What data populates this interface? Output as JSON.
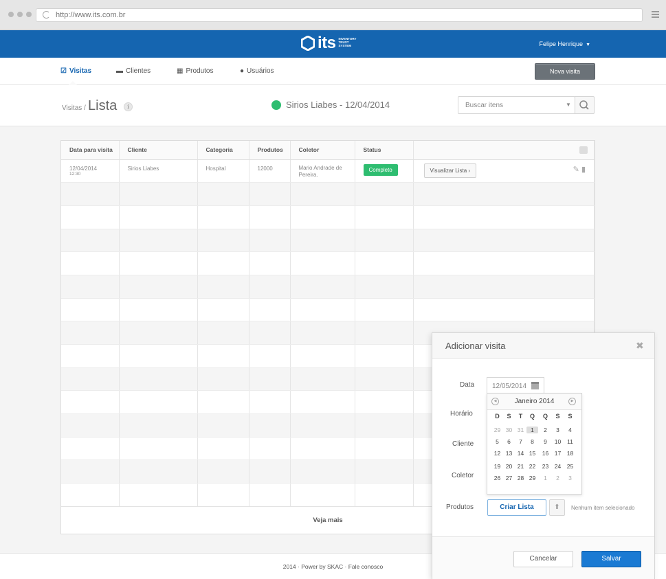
{
  "browser": {
    "url": "http://www.its.com.br"
  },
  "header": {
    "logo_text": "its",
    "logo_sub": "INVENTORY TRUST SYSTEM",
    "user_name": "Felipe Henrique",
    "brand_color": "#1565b0"
  },
  "nav": {
    "items": [
      {
        "label": "Visitas",
        "icon": "check-square-icon",
        "active": true
      },
      {
        "label": "Clientes",
        "icon": "briefcase-icon"
      },
      {
        "label": "Produtos",
        "icon": "cubes-icon"
      },
      {
        "label": "Usuários",
        "icon": "user-icon"
      }
    ],
    "new_visit_label": "Nova visita"
  },
  "subheader": {
    "breadcrumb": "Visitas /",
    "title": "Lista",
    "visit_title": "Sirios Liabes - 12/04/2014",
    "status_color": "#2ebd70",
    "search_placeholder": "Buscar itens"
  },
  "table": {
    "columns": [
      "Data para visita",
      "Cliente",
      "Categoria",
      "Produtos",
      "Coletor",
      "Status",
      ""
    ],
    "rows": [
      {
        "date": "12/04/2014",
        "time": "12:30",
        "cliente": "Sirios Liabes",
        "categoria": "Hospital",
        "produtos": "12000",
        "coletor": "Mario Andrade de Pereira.",
        "status": "Completo",
        "action": "Visualizar Lista"
      }
    ],
    "more_label": "Veja mais"
  },
  "footer": {
    "text": "2014 · Power by SKAC · Fale conosco"
  },
  "modal": {
    "title": "Adicionar visita",
    "labels": {
      "data": "Data",
      "horario": "Horário",
      "cliente": "Cliente",
      "coletor": "Coletor",
      "produtos": "Produtos"
    },
    "date_value": "12/05/2014",
    "calendar": {
      "month": "Janeiro 2014",
      "weekdays": [
        "D",
        "S",
        "T",
        "Q",
        "Q",
        "S",
        "S"
      ],
      "weeks": [
        [
          "29",
          "30",
          "31",
          "1",
          "2",
          "3",
          "4"
        ],
        [
          "5",
          "6",
          "7",
          "8",
          "9",
          "10",
          "11"
        ],
        [
          "12",
          "13",
          "14",
          "15",
          "16",
          "17",
          "18"
        ],
        [
          "19",
          "20",
          "21",
          "22",
          "23",
          "24",
          "25"
        ],
        [
          "26",
          "27",
          "28",
          "29",
          "1",
          "2",
          "3"
        ]
      ],
      "selected": "1"
    },
    "criar_lista": "Criar Lista",
    "no_item": "Nenhum item selecionado",
    "cancel": "Cancelar",
    "save": "Salvar"
  }
}
